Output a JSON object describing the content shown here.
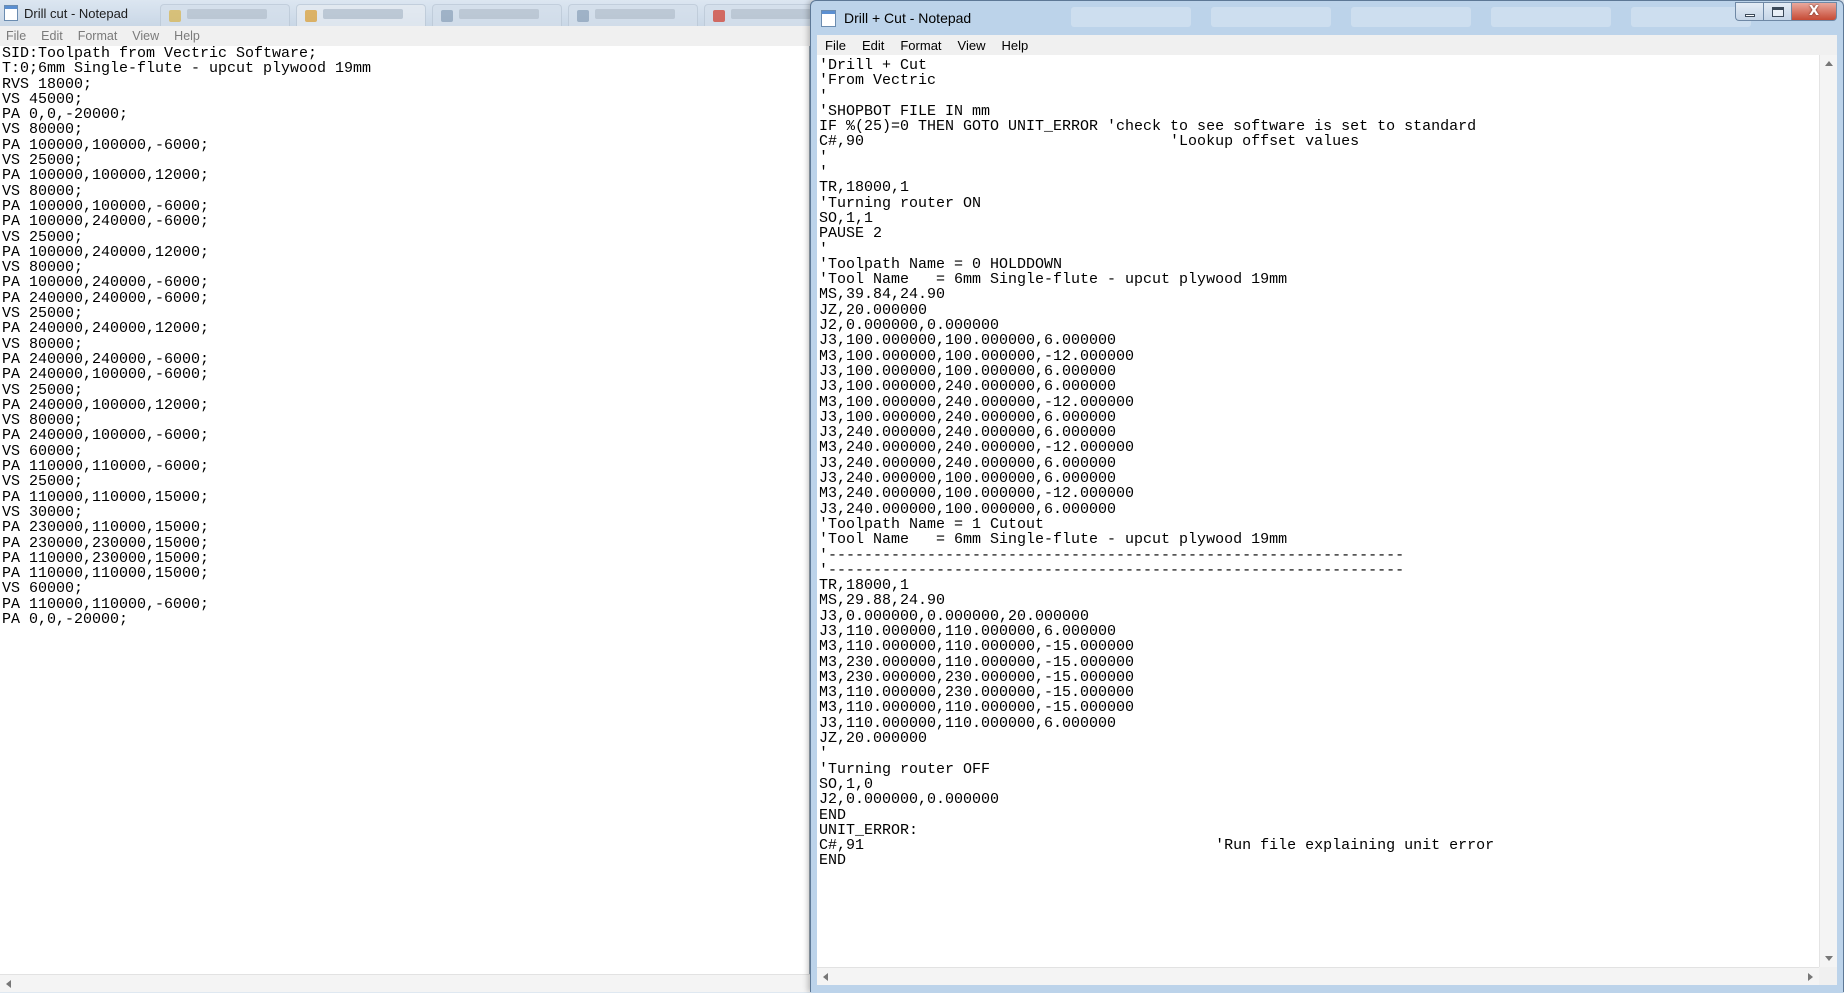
{
  "left_window": {
    "title": "Drill cut - Notepad",
    "menu": [
      "File",
      "Edit",
      "Format",
      "View",
      "Help"
    ],
    "lines": [
      "SID:Toolpath from Vectric Software;",
      "T:0;6mm Single-flute - upcut plywood 19mm",
      "RVS 18000;",
      "VS 45000;",
      "PA 0,0,-20000;",
      "VS 80000;",
      "PA 100000,100000,-6000;",
      "VS 25000;",
      "PA 100000,100000,12000;",
      "VS 80000;",
      "PA 100000,100000,-6000;",
      "PA 100000,240000,-6000;",
      "VS 25000;",
      "PA 100000,240000,12000;",
      "VS 80000;",
      "PA 100000,240000,-6000;",
      "PA 240000,240000,-6000;",
      "VS 25000;",
      "PA 240000,240000,12000;",
      "VS 80000;",
      "PA 240000,240000,-6000;",
      "PA 240000,100000,-6000;",
      "VS 25000;",
      "PA 240000,100000,12000;",
      "VS 80000;",
      "PA 240000,100000,-6000;",
      "VS 60000;",
      "PA 110000,110000,-6000;",
      "VS 25000;",
      "PA 110000,110000,15000;",
      "VS 30000;",
      "PA 230000,110000,15000;",
      "PA 230000,230000,15000;",
      "PA 110000,230000,15000;",
      "PA 110000,110000,15000;",
      "VS 60000;",
      "PA 110000,110000,-6000;",
      "PA 0,0,-20000;"
    ]
  },
  "right_window": {
    "title": "Drill + Cut - Notepad",
    "menu": [
      "File",
      "Edit",
      "Format",
      "View",
      "Help"
    ],
    "caption_buttons": {
      "close": "X"
    },
    "lines": [
      "'Drill + Cut",
      "'From Vectric",
      "'",
      "'SHOPBOT FILE IN mm",
      "IF %(25)=0 THEN GOTO UNIT_ERROR 'check to see software is set to standard",
      "C#,90                                  'Lookup offset values",
      "'",
      "'",
      "TR,18000,1",
      "'Turning router ON",
      "SO,1,1",
      "PAUSE 2",
      "'",
      "'Toolpath Name = 0 HOLDDOWN",
      "'Tool Name   = 6mm Single-flute - upcut plywood 19mm",
      "MS,39.84,24.90",
      "JZ,20.000000",
      "J2,0.000000,0.000000",
      "J3,100.000000,100.000000,6.000000",
      "M3,100.000000,100.000000,-12.000000",
      "J3,100.000000,100.000000,6.000000",
      "J3,100.000000,240.000000,6.000000",
      "M3,100.000000,240.000000,-12.000000",
      "J3,100.000000,240.000000,6.000000",
      "J3,240.000000,240.000000,6.000000",
      "M3,240.000000,240.000000,-12.000000",
      "J3,240.000000,240.000000,6.000000",
      "J3,240.000000,100.000000,6.000000",
      "M3,240.000000,100.000000,-12.000000",
      "J3,240.000000,100.000000,6.000000",
      "'Toolpath Name = 1 Cutout",
      "'Tool Name   = 6mm Single-flute - upcut plywood 19mm",
      "'----------------------------------------------------------------",
      "'----------------------------------------------------------------",
      "TR,18000,1",
      "MS,29.88,24.90",
      "J3,0.000000,0.000000,20.000000",
      "J3,110.000000,110.000000,6.000000",
      "M3,110.000000,110.000000,-15.000000",
      "M3,230.000000,110.000000,-15.000000",
      "M3,230.000000,230.000000,-15.000000",
      "M3,110.000000,230.000000,-15.000000",
      "M3,110.000000,110.000000,-15.000000",
      "J3,110.000000,110.000000,6.000000",
      "JZ,20.000000",
      "'",
      "'Turning router OFF",
      "SO,1,0",
      "J2,0.000000,0.000000",
      "END",
      "UNIT_ERROR:",
      "C#,91                                       'Run file explaining unit error",
      "END"
    ]
  }
}
